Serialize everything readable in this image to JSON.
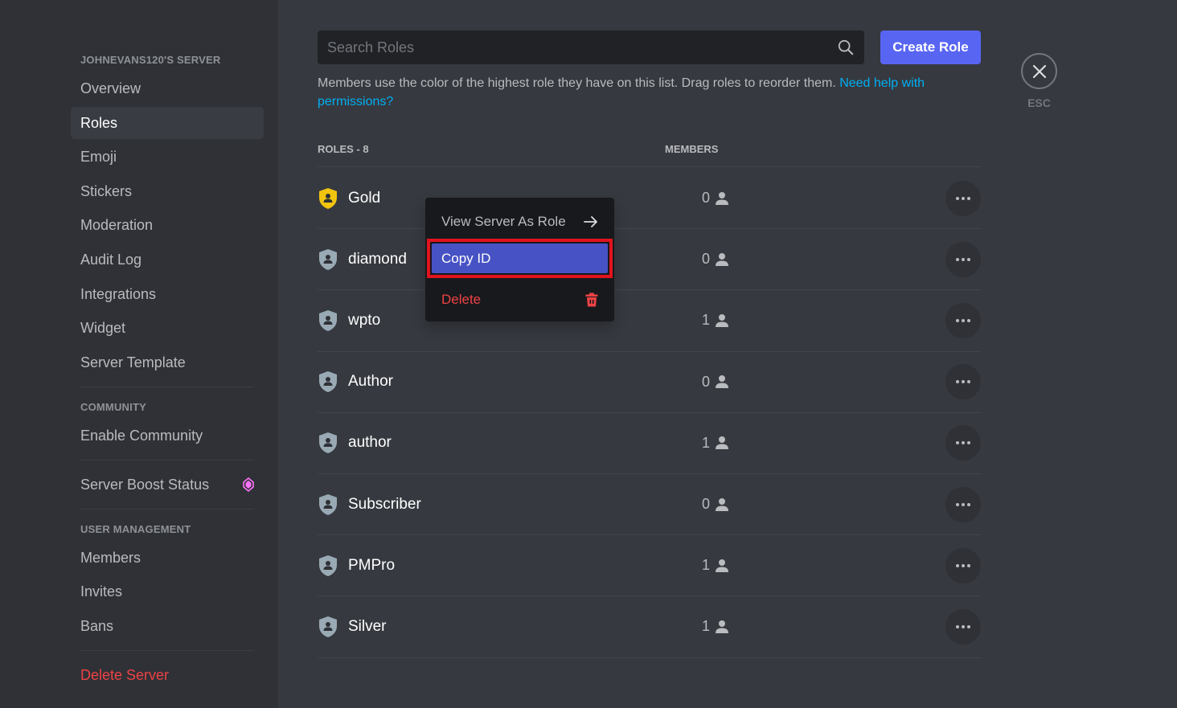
{
  "sidebar": {
    "server_header": "JOHNEVANS120'S SERVER",
    "server_items": [
      {
        "label": "Overview",
        "active": false
      },
      {
        "label": "Roles",
        "active": true
      },
      {
        "label": "Emoji",
        "active": false
      },
      {
        "label": "Stickers",
        "active": false
      },
      {
        "label": "Moderation",
        "active": false
      },
      {
        "label": "Audit Log",
        "active": false
      },
      {
        "label": "Integrations",
        "active": false
      },
      {
        "label": "Widget",
        "active": false
      },
      {
        "label": "Server Template",
        "active": false
      }
    ],
    "community_header": "COMMUNITY",
    "community_items": [
      {
        "label": "Enable Community"
      }
    ],
    "boost_item": {
      "label": "Server Boost Status",
      "icon": "boost-gem-icon"
    },
    "user_mgmt_header": "USER MANAGEMENT",
    "user_mgmt_items": [
      {
        "label": "Members"
      },
      {
        "label": "Invites"
      },
      {
        "label": "Bans"
      }
    ],
    "delete_server": "Delete Server"
  },
  "search": {
    "placeholder": "Search Roles",
    "value": ""
  },
  "create_role_label": "Create Role",
  "description": {
    "text": "Members use the color of the highest role they have on this list. Drag roles to reorder them. ",
    "link": "Need help with permissions?"
  },
  "table": {
    "roles_header": "ROLES - 8",
    "members_header": "MEMBERS",
    "roles": [
      {
        "name": "Gold",
        "members": "0",
        "color": "#f1c40f"
      },
      {
        "name": "diamond",
        "members": "0",
        "color": "#99aab5"
      },
      {
        "name": "wpto",
        "members": "1",
        "color": "#99aab5"
      },
      {
        "name": "Author",
        "members": "0",
        "color": "#99aab5"
      },
      {
        "name": "author",
        "members": "1",
        "color": "#99aab5"
      },
      {
        "name": "Subscriber",
        "members": "0",
        "color": "#99aab5"
      },
      {
        "name": "PMPro",
        "members": "1",
        "color": "#99aab5"
      },
      {
        "name": "Silver",
        "members": "1",
        "color": "#99aab5"
      }
    ]
  },
  "context_menu": {
    "view_as_role": "View Server As Role",
    "copy_id": "Copy ID",
    "delete": "Delete"
  },
  "close": {
    "esc_label": "ESC"
  },
  "colors": {
    "accent": "#5865f2",
    "danger": "#ed4245",
    "link": "#00aff4",
    "highlight_box": "#e0131e",
    "boost": "#ff73fa"
  }
}
